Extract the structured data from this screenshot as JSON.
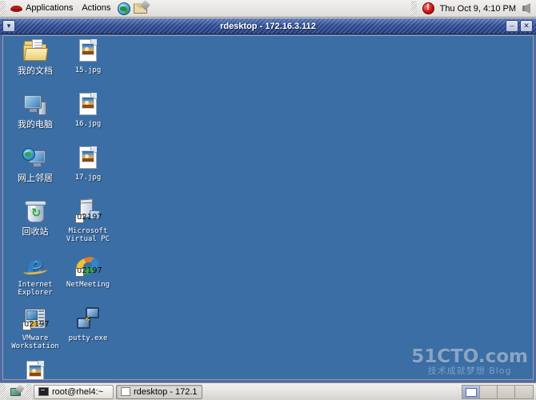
{
  "top_panel": {
    "distro_icon": "redhat-icon",
    "menus": [
      {
        "label": "Applications"
      },
      {
        "label": "Actions"
      }
    ],
    "launchers": [
      {
        "name": "web-browser-launcher",
        "icon": "globe-icon"
      },
      {
        "name": "email-launcher",
        "icon": "envelope-icon"
      }
    ],
    "tray": {
      "alert_icon": "alert-update-icon",
      "clock": "Thu Oct  9,  4:10 PM",
      "volume_icon": "speaker-icon"
    }
  },
  "window": {
    "title": "rdesktop - 172.16.3.112",
    "menu_button_icon": "chevron-down-icon",
    "minimize_label": "–",
    "close_label": "✕"
  },
  "desktop": {
    "background_color": "#3b6ea5",
    "icons": [
      {
        "name": "my-documents",
        "label": "我的文档",
        "icon": "folder-documents-icon",
        "cjk": true,
        "col": 0,
        "row": 0
      },
      {
        "name": "my-computer",
        "label": "我的电脑",
        "icon": "computer-icon",
        "cjk": true,
        "col": 0,
        "row": 1
      },
      {
        "name": "network-places",
        "label": "网上邻居",
        "icon": "network-icon",
        "cjk": true,
        "col": 0,
        "row": 2
      },
      {
        "name": "recycle-bin",
        "label": "回收站",
        "icon": "recycle-bin-icon",
        "cjk": true,
        "col": 0,
        "row": 3
      },
      {
        "name": "internet-explorer",
        "label": "Internet Explorer",
        "icon": "internet-explorer-icon",
        "cjk": false,
        "col": 0,
        "row": 4
      },
      {
        "name": "vmware-workstation",
        "label": "VMware Workstation",
        "icon": "vmware-icon",
        "cjk": false,
        "col": 0,
        "row": 5
      },
      {
        "name": "file-15-jpg",
        "label": "15.jpg",
        "icon": "jpeg-file-icon",
        "cjk": false,
        "col": 1,
        "row": 0
      },
      {
        "name": "file-16-jpg",
        "label": "16.jpg",
        "icon": "jpeg-file-icon",
        "cjk": false,
        "col": 1,
        "row": 1
      },
      {
        "name": "file-17-jpg",
        "label": "17.jpg",
        "icon": "jpeg-file-icon",
        "cjk": false,
        "col": 1,
        "row": 2
      },
      {
        "name": "microsoft-virtual-pc",
        "label": "Microsoft Virtual PC",
        "icon": "virtual-pc-icon",
        "cjk": false,
        "col": 1,
        "row": 3
      },
      {
        "name": "netmeeting",
        "label": "NetMeeting",
        "icon": "netmeeting-icon",
        "cjk": false,
        "col": 1,
        "row": 4
      },
      {
        "name": "putty-exe",
        "label": "putty.exe",
        "icon": "putty-icon",
        "cjk": false,
        "col": 1,
        "row": 5
      }
    ],
    "partial_icon": {
      "name": "file-jpg-partial",
      "icon": "jpeg-file-icon"
    }
  },
  "watermark": {
    "main": "51CTO.com",
    "sub": "技术成就梦想  Blog"
  },
  "bottom_panel": {
    "show_desktop_icon": "show-desktop-icon",
    "tasks": [
      {
        "name": "task-terminal",
        "label": "root@rhel4:~",
        "icon": "terminal-icon",
        "active": false
      },
      {
        "name": "task-rdesktop",
        "label": "rdesktop - 172.1",
        "icon": "window-icon",
        "active": true
      }
    ],
    "workspaces": [
      {
        "active": true
      },
      {
        "active": false
      },
      {
        "active": false
      },
      {
        "active": false
      }
    ]
  }
}
